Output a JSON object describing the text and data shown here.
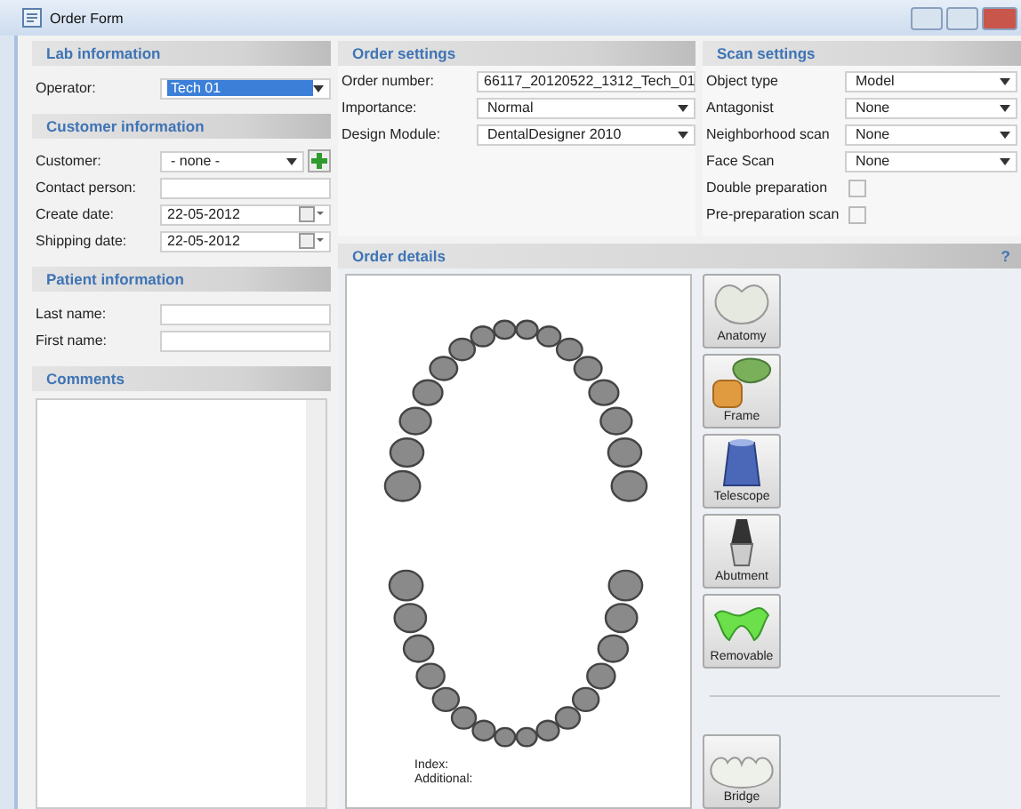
{
  "window": {
    "title": "Order Form"
  },
  "lab_information": {
    "title": "Lab information",
    "fields": [
      {
        "label": "Operator:",
        "kind": "dropdown",
        "value": "Tech 01",
        "highlighted": true
      }
    ]
  },
  "customer_information": {
    "title": "Customer information",
    "fields": [
      {
        "label": "Customer:",
        "kind": "dropdown_add",
        "value": "- none -"
      },
      {
        "label": "Contact person:",
        "kind": "text"
      },
      {
        "label": "Create date:",
        "kind": "date",
        "value": "22-05-2012"
      },
      {
        "label": "Shipping date:",
        "kind": "date",
        "value": "22-05-2012"
      }
    ]
  },
  "patient_information": {
    "title": "Patient information",
    "fields": [
      {
        "label": "Last name:",
        "kind": "text"
      },
      {
        "label": "First name:",
        "kind": "text"
      }
    ]
  },
  "comments": {
    "title": "Comments"
  },
  "order_settings": {
    "title": "Order settings",
    "fields": [
      {
        "label": "Order number:",
        "kind": "text",
        "value": "66117_20120522_1312_Tech_01"
      },
      {
        "label": "Importance:",
        "kind": "dropdown",
        "value": "Normal"
      },
      {
        "label": "Design Module:",
        "kind": "dropdown",
        "value": "DentalDesigner 2010"
      }
    ]
  },
  "scan_settings": {
    "title": "Scan settings",
    "fields": [
      {
        "label": "Object type",
        "kind": "dropdown",
        "value": "Model"
      },
      {
        "label": "Antagonist",
        "kind": "dropdown",
        "value": "None"
      },
      {
        "label": "Neighborhood scan",
        "kind": "dropdown",
        "value": "None"
      },
      {
        "label": "Face Scan",
        "kind": "dropdown",
        "value": "None"
      },
      {
        "label": "Double preparation",
        "kind": "checkbox",
        "checked": false
      },
      {
        "label": "Pre-preparation scan",
        "kind": "checkbox",
        "checked": false
      }
    ]
  },
  "order_details": {
    "title": "Order details",
    "help": "?",
    "index_label": "Index:",
    "additional_label": "Additional:",
    "tools": [
      {
        "label": "Anatomy",
        "kind": "anatomy"
      },
      {
        "label": "Frame",
        "kind": "frame"
      },
      {
        "label": "Telescope",
        "kind": "telescope"
      },
      {
        "label": "Abutment",
        "kind": "abutment"
      },
      {
        "label": "Removable",
        "kind": "removable"
      },
      {
        "label": "Bridge",
        "kind": "bridge"
      }
    ]
  }
}
